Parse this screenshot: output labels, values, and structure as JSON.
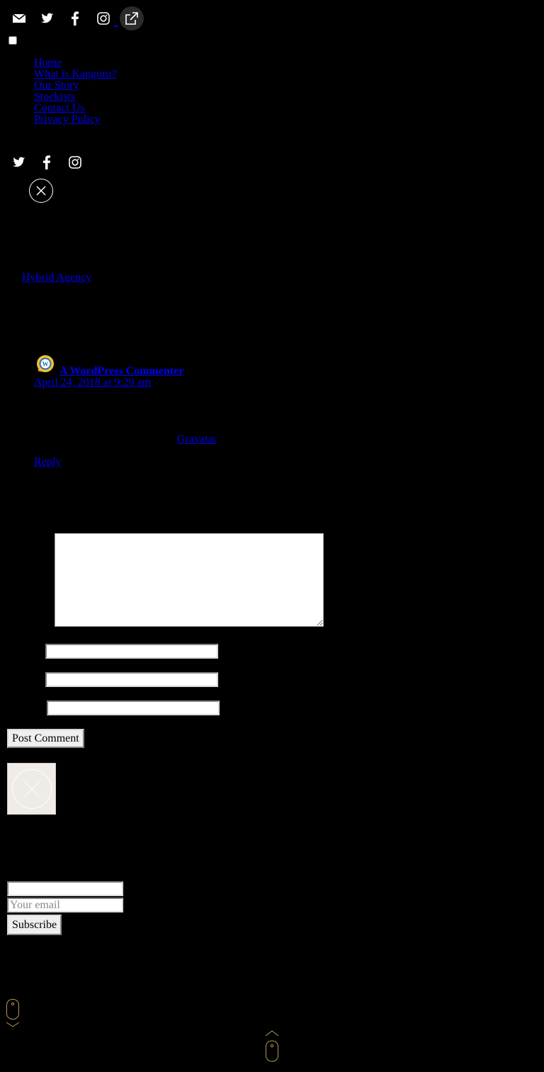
{
  "social_bar": {
    "icons": [
      "email-icon",
      "twitter-icon",
      "facebook-icon",
      "instagram-icon",
      "external-link-icon"
    ]
  },
  "nav": {
    "items": [
      {
        "label": "Home"
      },
      {
        "label": "What is Kanguru?"
      },
      {
        "label": "Our Story"
      },
      {
        "label": "Stockists"
      },
      {
        "label": "Contact Us"
      },
      {
        "label": "Privacy Policy"
      }
    ]
  },
  "social_secondary": {
    "icons": [
      "twitter-icon",
      "facebook-icon",
      "instagram-icon"
    ]
  },
  "credit": {
    "link_text": "Hybrid Agency"
  },
  "comment": {
    "author": "A WordPress Commenter",
    "date": "April 24, 2018 at 9:29 am",
    "gravatar_link": "Gravatar",
    "reply_label": "Reply"
  },
  "comment_form": {
    "comment_value": "",
    "name_value": "",
    "email_value": "",
    "website_value": "",
    "submit_label": "Post Comment"
  },
  "subscribe": {
    "name_value": "",
    "email_placeholder": "Your email",
    "submit_label": "Subscribe"
  },
  "colors": {
    "background": "#000000",
    "icon": "#ffffff",
    "link": "#0000ee",
    "scroll_indicator": "#b8935a",
    "close_box": "#efebe6"
  }
}
